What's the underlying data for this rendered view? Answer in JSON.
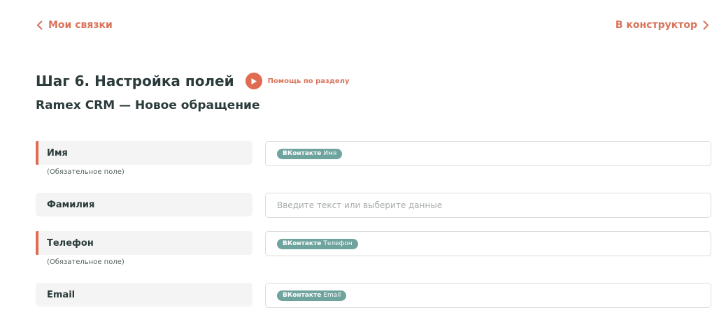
{
  "nav": {
    "back_label": "Мои связки",
    "forward_label": "В конструктор"
  },
  "header": {
    "title": "Шаг 6. Настройка полей",
    "help_label": "Помощь по разделу",
    "subtitle": "Ramex CRM — Новое обращение"
  },
  "fields": [
    {
      "label": "Имя",
      "note": "(Обязательное поле)",
      "chip_source": "ВКонтакте",
      "chip_value": "Имя"
    },
    {
      "label": "Фамилия",
      "placeholder": "Введите текст или выберите данные"
    },
    {
      "label": "Телефон",
      "note": "(Обязательное поле)",
      "chip_source": "ВКонтакте",
      "chip_value": "Телефон"
    },
    {
      "label": "Email",
      "chip_source": "ВКонтакте",
      "chip_value": "Email"
    }
  ],
  "colors": {
    "accent": "#e06b50",
    "link": "#d9735a",
    "chip": "#6fa39e",
    "text": "#2b3a3a"
  },
  "icons": {
    "back": "chevron-left-icon",
    "forward": "chevron-right-icon",
    "help": "play-icon"
  }
}
